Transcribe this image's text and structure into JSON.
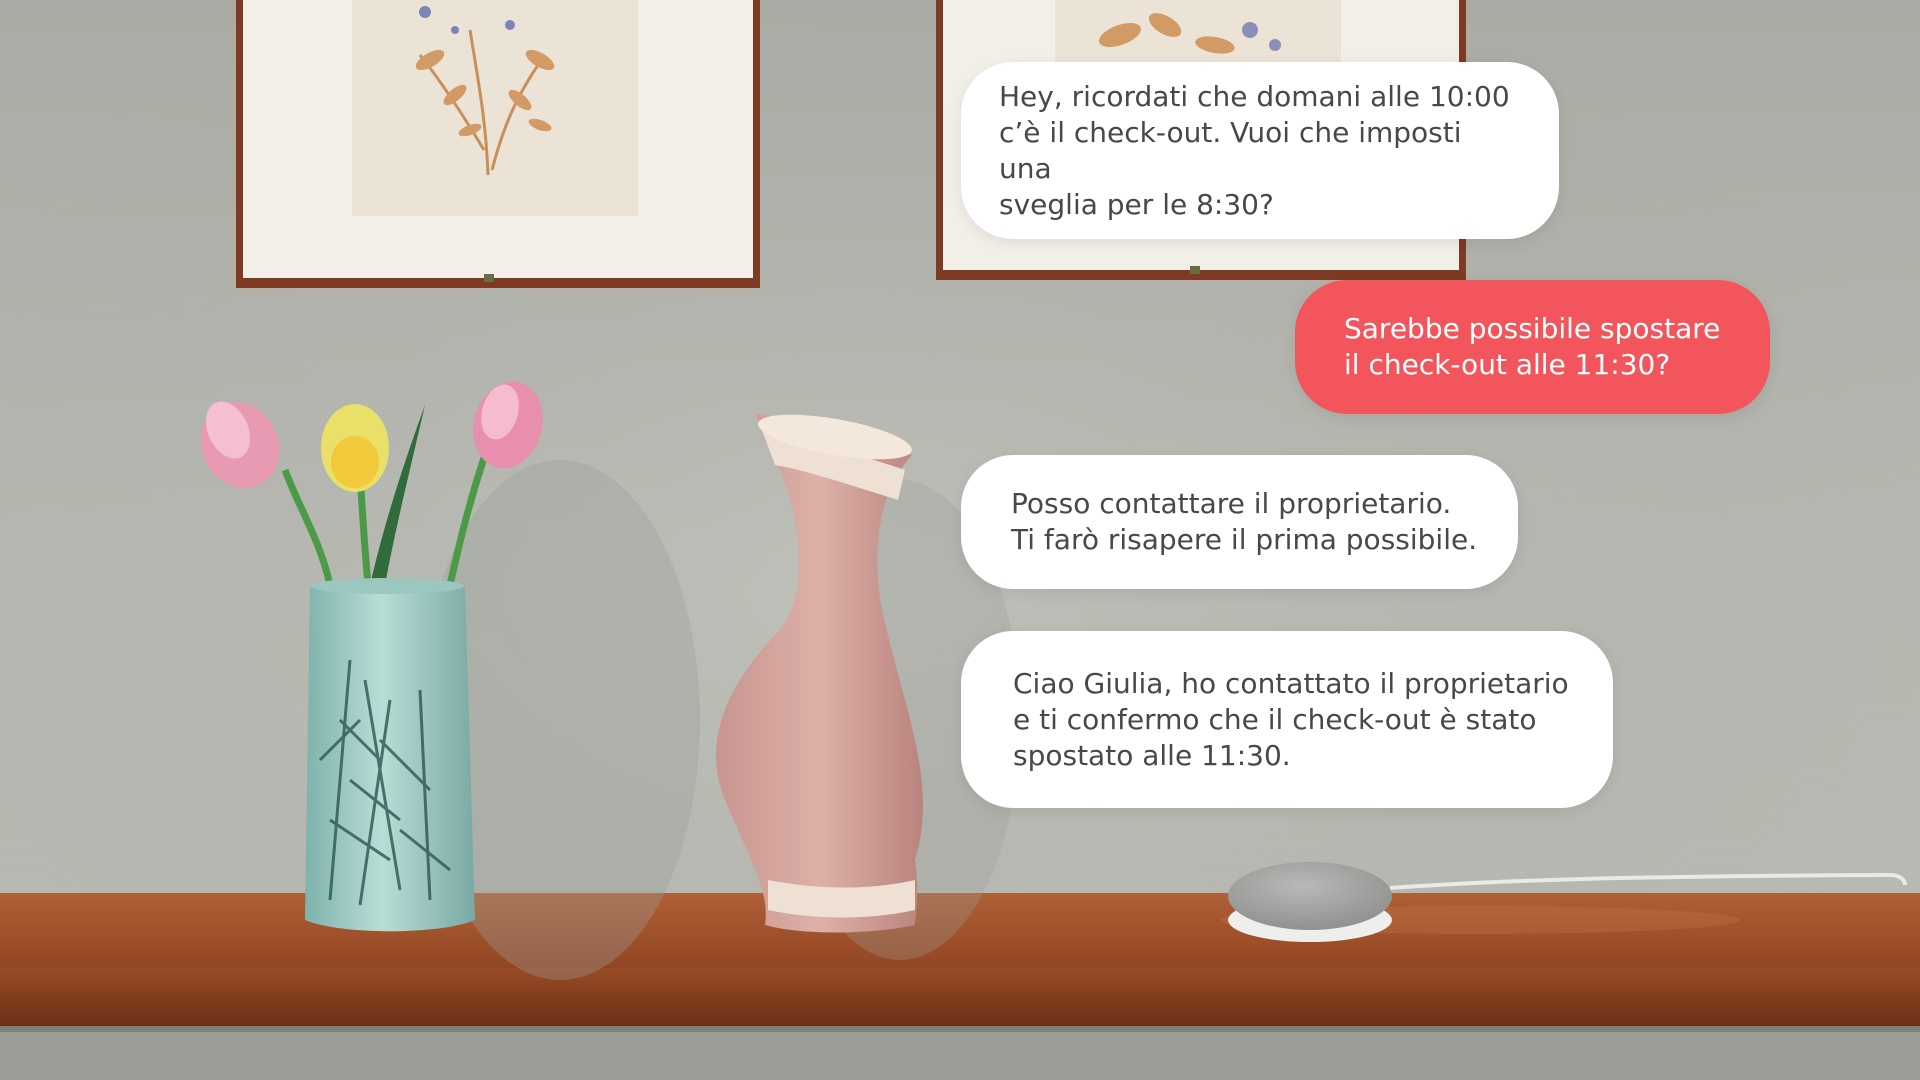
{
  "messages": [
    {
      "sender": "assistant",
      "text": "Hey,  ricordati che domani alle 10:00\nc’è il check-out. Vuoi che imposti una\nsveglia per le 8:30?"
    },
    {
      "sender": "guest",
      "text": "Sarebbe possibile spostare\nil check-out alle 11:30?"
    },
    {
      "sender": "assistant",
      "text": "Posso contattare il proprietario.\nTi farò risapere il prima possibile."
    },
    {
      "sender": "assistant",
      "text": "Ciao Giulia, ho contattato il proprietario\ne ti confermo che il check-out è stato\nspostato alle 11:30."
    }
  ],
  "colors": {
    "wall": "#b3b4ad",
    "shelf": "#9a4a25",
    "assistant_bubble": "#ffffff",
    "guest_bubble": "#f2565c",
    "assistant_text": "#484848",
    "guest_text": "#ffffff"
  }
}
